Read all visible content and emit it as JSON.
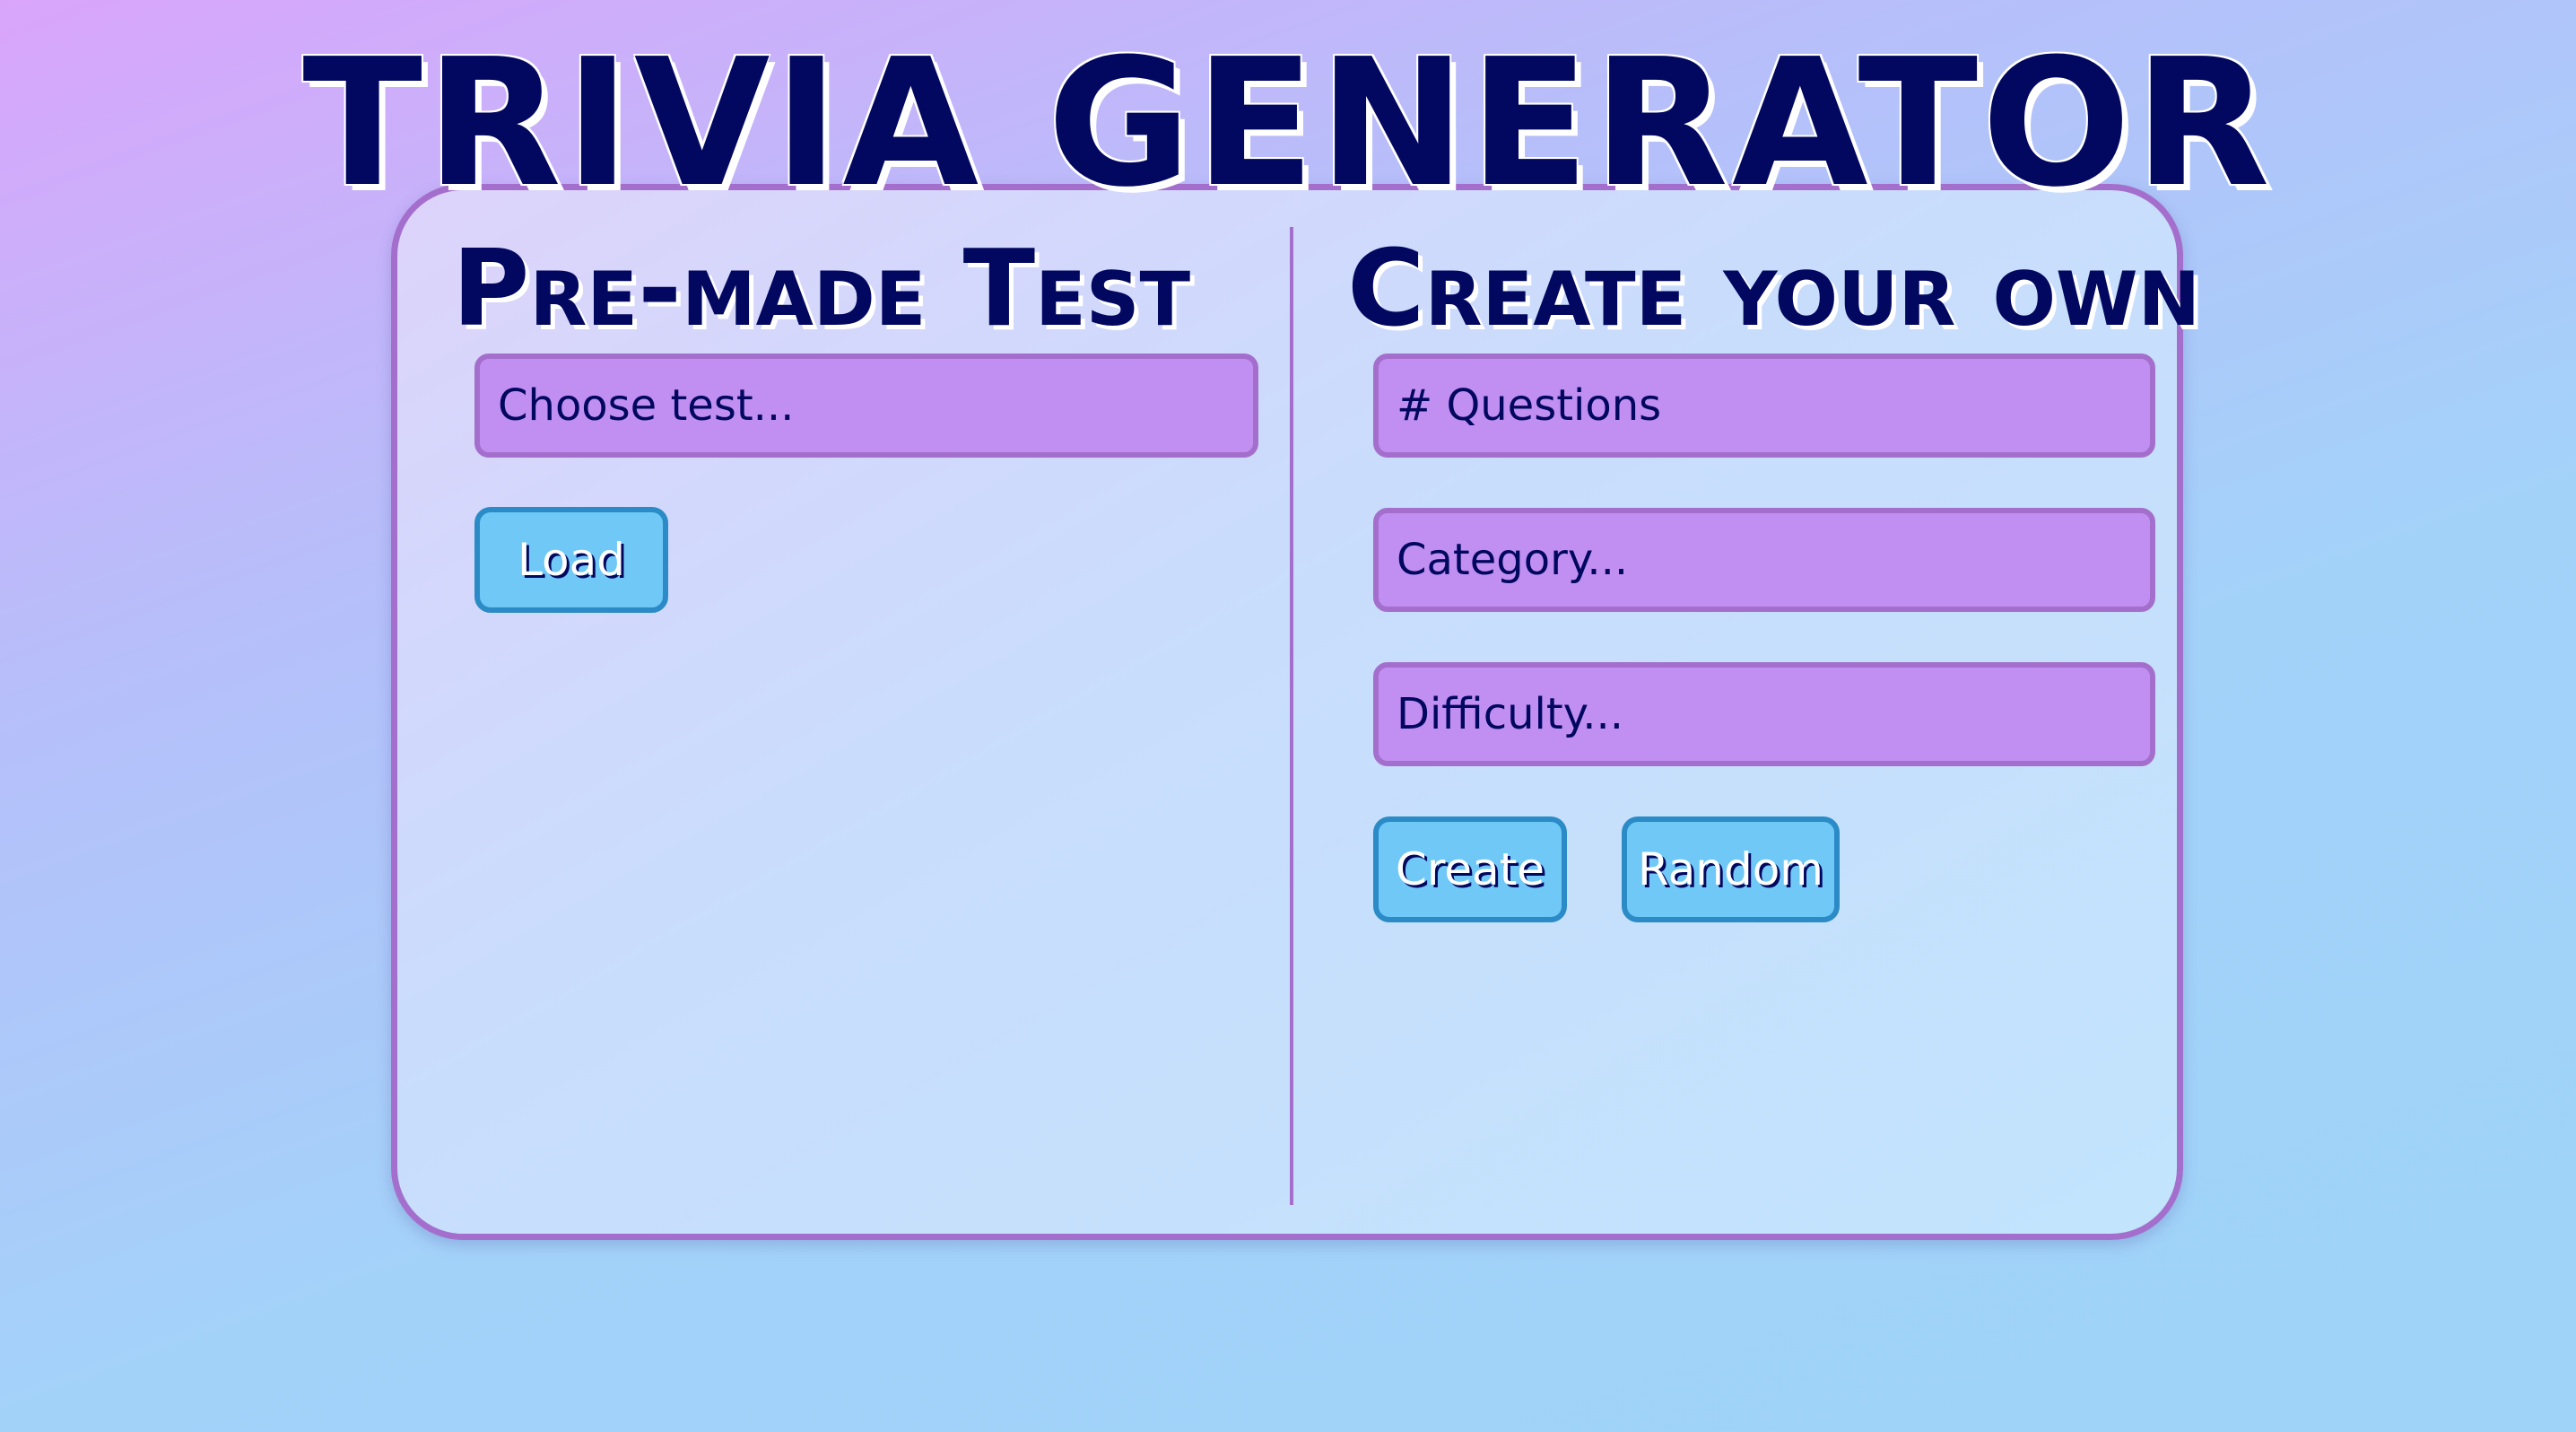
{
  "header": {
    "title": "TRIVIA GENERATOR"
  },
  "premade": {
    "heading": "Pre-made Test",
    "choose_test_placeholder": "Choose test...",
    "load_label": "Load"
  },
  "custom": {
    "heading": "Create your own",
    "questions_placeholder": "# Questions",
    "category_placeholder": "Category...",
    "difficulty_placeholder": "Difficulty...",
    "create_label": "Create",
    "random_label": "Random"
  },
  "colors": {
    "text": "#02085f",
    "field": "#c08ff1",
    "border": "#a46fcc",
    "button": "#70c8f6"
  }
}
